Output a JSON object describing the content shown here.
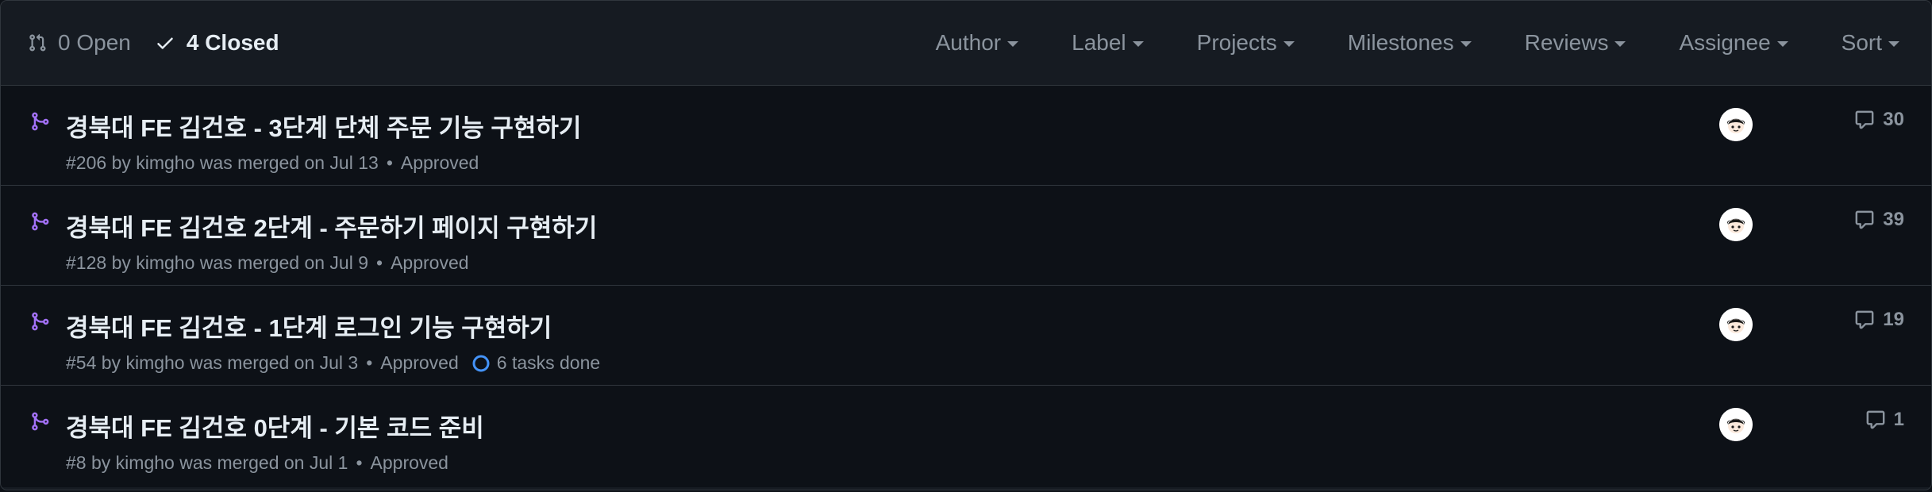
{
  "header": {
    "open_count_label": "0 Open",
    "closed_count_label": "4 Closed",
    "filters": [
      "Author",
      "Label",
      "Projects",
      "Milestones",
      "Reviews",
      "Assignee",
      "Sort"
    ]
  },
  "pull_requests": [
    {
      "title": "경북대 FE 김건호 - 3단계 단체 주문 기능 구현하기",
      "number": "#206",
      "by": "by",
      "author": "kimgho",
      "merged_text": "was merged on Jul 13",
      "review_status": "Approved",
      "tasks": "",
      "comments": "30"
    },
    {
      "title": "경북대 FE 김건호 2단계 - 주문하기 페이지 구현하기",
      "number": "#128",
      "by": "by",
      "author": "kimgho",
      "merged_text": "was merged on Jul 9",
      "review_status": "Approved",
      "tasks": "",
      "comments": "39"
    },
    {
      "title": "경북대 FE 김건호 - 1단계 로그인 기능 구현하기",
      "number": "#54",
      "by": "by",
      "author": "kimgho",
      "merged_text": "was merged on Jul 3",
      "review_status": "Approved",
      "tasks": "6 tasks done",
      "comments": "19"
    },
    {
      "title": "경북대 FE 김건호 0단계 - 기본 코드 준비",
      "number": "#8",
      "by": "by",
      "author": "kimgho",
      "merged_text": "was merged on Jul 1",
      "review_status": "Approved",
      "tasks": "",
      "comments": "1"
    }
  ],
  "colors": {
    "background": "#0d1117",
    "header_background": "#161b22",
    "border": "#30363d",
    "text_primary": "#e6edf3",
    "text_muted": "#8b949e",
    "merged_purple": "#a371f7",
    "task_ring_blue": "#4493f8"
  },
  "icons": {
    "open_state": "git-pull-request-icon",
    "closed_state": "check-icon",
    "row_state": "git-merge-icon",
    "comments": "comment-icon",
    "tasks": "task-progress-ring-icon"
  }
}
